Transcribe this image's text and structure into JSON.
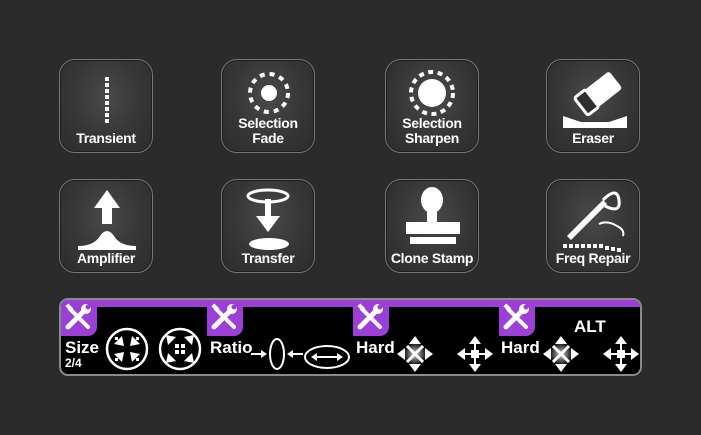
{
  "tools": [
    {
      "id": "transient",
      "label_lines": [
        "Transient"
      ],
      "icon": "transient-icon"
    },
    {
      "id": "selection-fade",
      "label_lines": [
        "Selection",
        "Fade"
      ],
      "icon": "selection-fade-icon"
    },
    {
      "id": "selection-sharpen",
      "label_lines": [
        "Selection",
        "Sharpen"
      ],
      "icon": "selection-sharpen-icon"
    },
    {
      "id": "eraser",
      "label_lines": [
        "Eraser"
      ],
      "icon": "eraser-icon"
    },
    {
      "id": "amplifier",
      "label_lines": [
        "Amplifier"
      ],
      "icon": "amplifier-icon"
    },
    {
      "id": "transfer",
      "label_lines": [
        "Transfer"
      ],
      "icon": "transfer-icon"
    },
    {
      "id": "clone-stamp",
      "label_lines": [
        "Clone Stamp"
      ],
      "icon": "clone-stamp-icon"
    },
    {
      "id": "freq-repair",
      "label_lines": [
        "Freq Repair"
      ],
      "icon": "freq-repair-icon"
    }
  ],
  "strip": {
    "accent": "#9b3fd6",
    "size_label": "Size",
    "size_value": "2/4",
    "ratio_label": "Ratio",
    "hard_label_1": "Hard",
    "hard_label_2": "Hard",
    "alt_label": "ALT",
    "icons": [
      "wrench-screwdriver-icon",
      "shrink-arrows-icon",
      "expand-arrows-icon",
      "ratio-narrow-icon",
      "ratio-wide-icon",
      "hard-move-icon",
      "soft-move-icon",
      "hard-move-alt-icon",
      "soft-move-alt-icon"
    ]
  }
}
